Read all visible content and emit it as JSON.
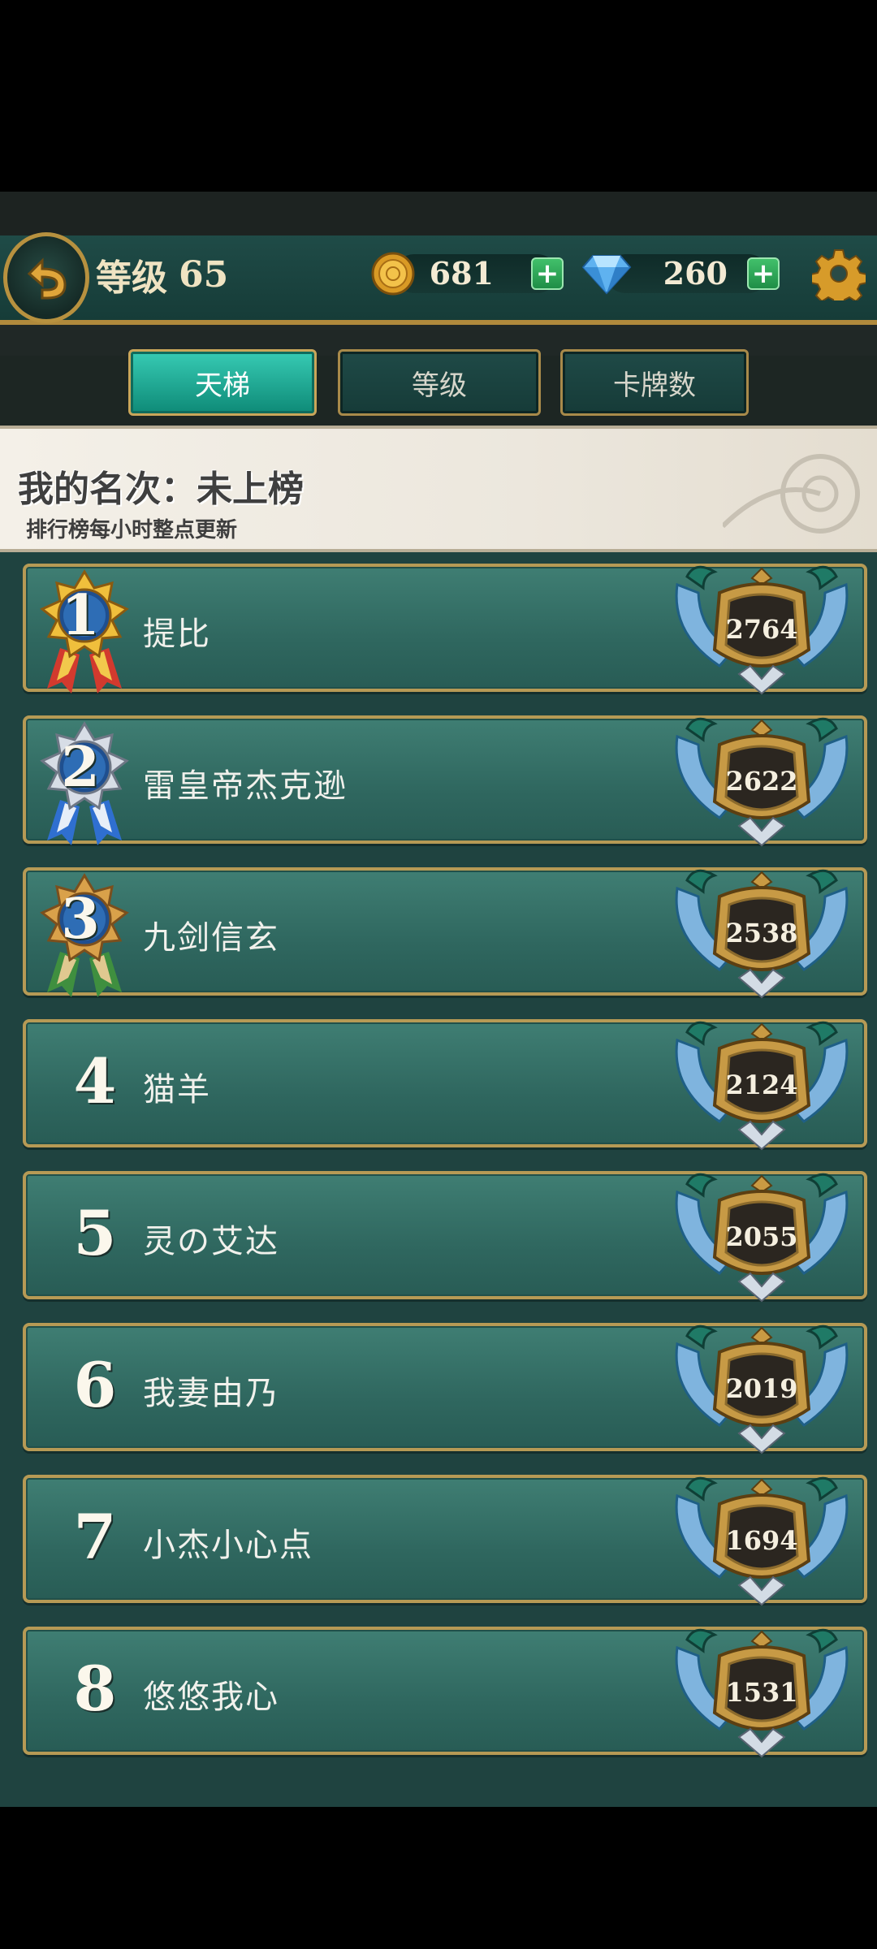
{
  "header": {
    "level_label": "等级",
    "level_value": "65",
    "gold": "681",
    "diamonds": "260",
    "plus_label": "+"
  },
  "tabs": [
    {
      "label": "天梯",
      "active": true
    },
    {
      "label": "等级",
      "active": false
    },
    {
      "label": "卡牌数",
      "active": false
    }
  ],
  "my_rank": {
    "text": "我的名次：未上榜",
    "note": "排行榜每小时整点更新"
  },
  "leaderboard": [
    {
      "rank": "1",
      "name": "提比",
      "score": "2764",
      "medal": "gold"
    },
    {
      "rank": "2",
      "name": "雷皇帝杰克逊",
      "score": "2622",
      "medal": "silver"
    },
    {
      "rank": "3",
      "name": "九剑信玄",
      "score": "2538",
      "medal": "bronze"
    },
    {
      "rank": "4",
      "name": "猫羊",
      "score": "2124"
    },
    {
      "rank": "5",
      "name": "灵の艾达",
      "score": "2055"
    },
    {
      "rank": "6",
      "name": "我妻由乃",
      "score": "2019"
    },
    {
      "rank": "7",
      "name": "小杰小心点",
      "score": "1694"
    },
    {
      "rank": "8",
      "name": "悠悠我心",
      "score": "1531"
    }
  ]
}
